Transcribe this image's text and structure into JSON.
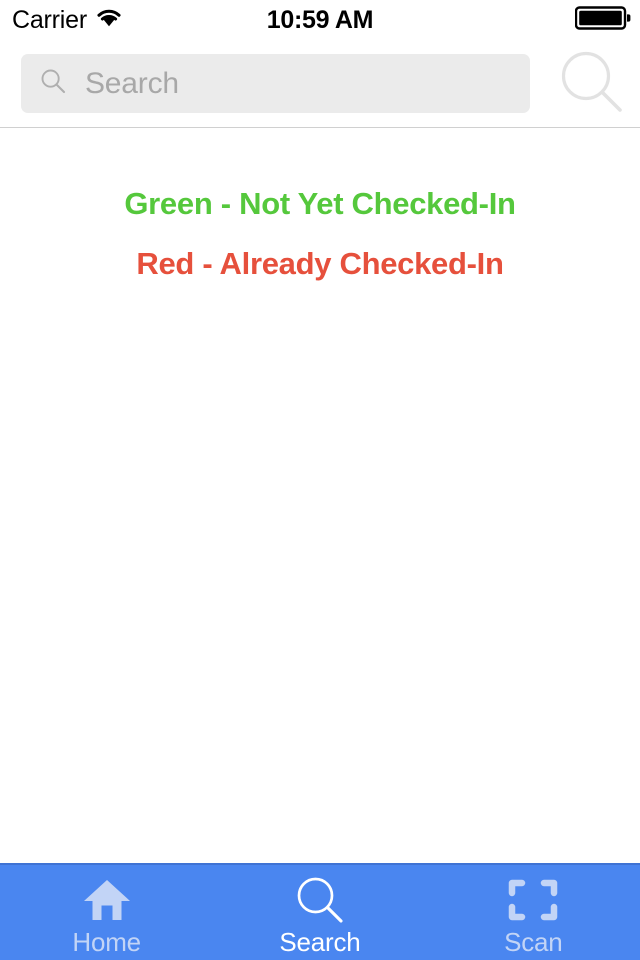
{
  "status_bar": {
    "carrier": "Carrier",
    "wifi_icon": "wifi-icon",
    "time": "10:59 AM",
    "battery_icon": "battery-full-icon"
  },
  "search_header": {
    "field_icon": "search-icon",
    "placeholder": "Search",
    "value": "",
    "button_icon": "search-icon"
  },
  "content": {
    "legend": [
      {
        "text": "Green - Not Yet Checked-In",
        "color": "#55c83c"
      },
      {
        "text": "Red - Already Checked-In",
        "color": "#e6503c"
      }
    ]
  },
  "tab_bar": {
    "background_color": "#4a86f0",
    "active_color": "#ffffff",
    "inactive_color": "#c2d4f6",
    "items": [
      {
        "label": "Home",
        "icon": "home-icon",
        "active": false
      },
      {
        "label": "Search",
        "icon": "search-icon",
        "active": true
      },
      {
        "label": "Scan",
        "icon": "scan-frame-icon",
        "active": false
      }
    ]
  }
}
